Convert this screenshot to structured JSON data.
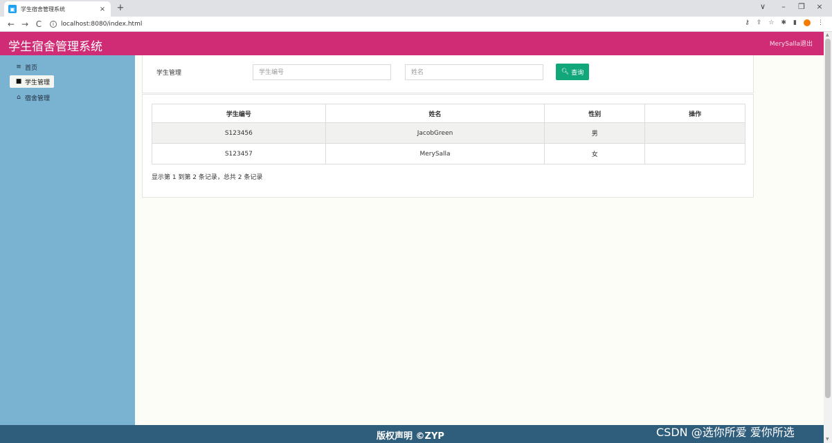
{
  "browser": {
    "tab_title": "学生宿舍管理系统",
    "tab_close": "×",
    "new_tab": "+",
    "url": "localhost:8080/index.html",
    "nav_back": "←",
    "nav_forward": "→",
    "nav_reload": "C",
    "window_controls": [
      "∨",
      "–",
      "❐",
      "×"
    ]
  },
  "header": {
    "title": "学生宿舍管理系统",
    "user_name": "MerySalla",
    "logout": "退出"
  },
  "sidebar": {
    "items": [
      {
        "label": "首页",
        "icon": "menu-icon",
        "glyph": "≡",
        "active": false
      },
      {
        "label": "学生管理",
        "icon": "user-icon",
        "glyph": "■",
        "active": true
      },
      {
        "label": "宿舍管理",
        "icon": "home-icon",
        "glyph": "⌂",
        "active": false
      }
    ]
  },
  "search": {
    "label": "学生管理",
    "student_id_placeholder": "学生编号",
    "name_placeholder": "姓名",
    "query_button": "查询",
    "query_icon": "search-icon"
  },
  "table": {
    "columns": [
      "学生编号",
      "姓名",
      "性别",
      "操作"
    ],
    "rows": [
      [
        "S123456",
        "JacobGreen",
        "男",
        ""
      ],
      [
        "S123457",
        "MerySalla",
        "女",
        ""
      ]
    ]
  },
  "pagination": {
    "summary": "显示第 1 到第 2 条记录，总共 2 条记录"
  },
  "footer": {
    "text": "版权声明 ©ZYP"
  },
  "watermark": "CSDN @选你所爱 爱你所选",
  "colors": {
    "header_bg": "#d02c76",
    "sidebar_bg": "#7ab2d2",
    "footer_bg": "#2f5d7c",
    "query_button_bg": "#11a77b"
  }
}
